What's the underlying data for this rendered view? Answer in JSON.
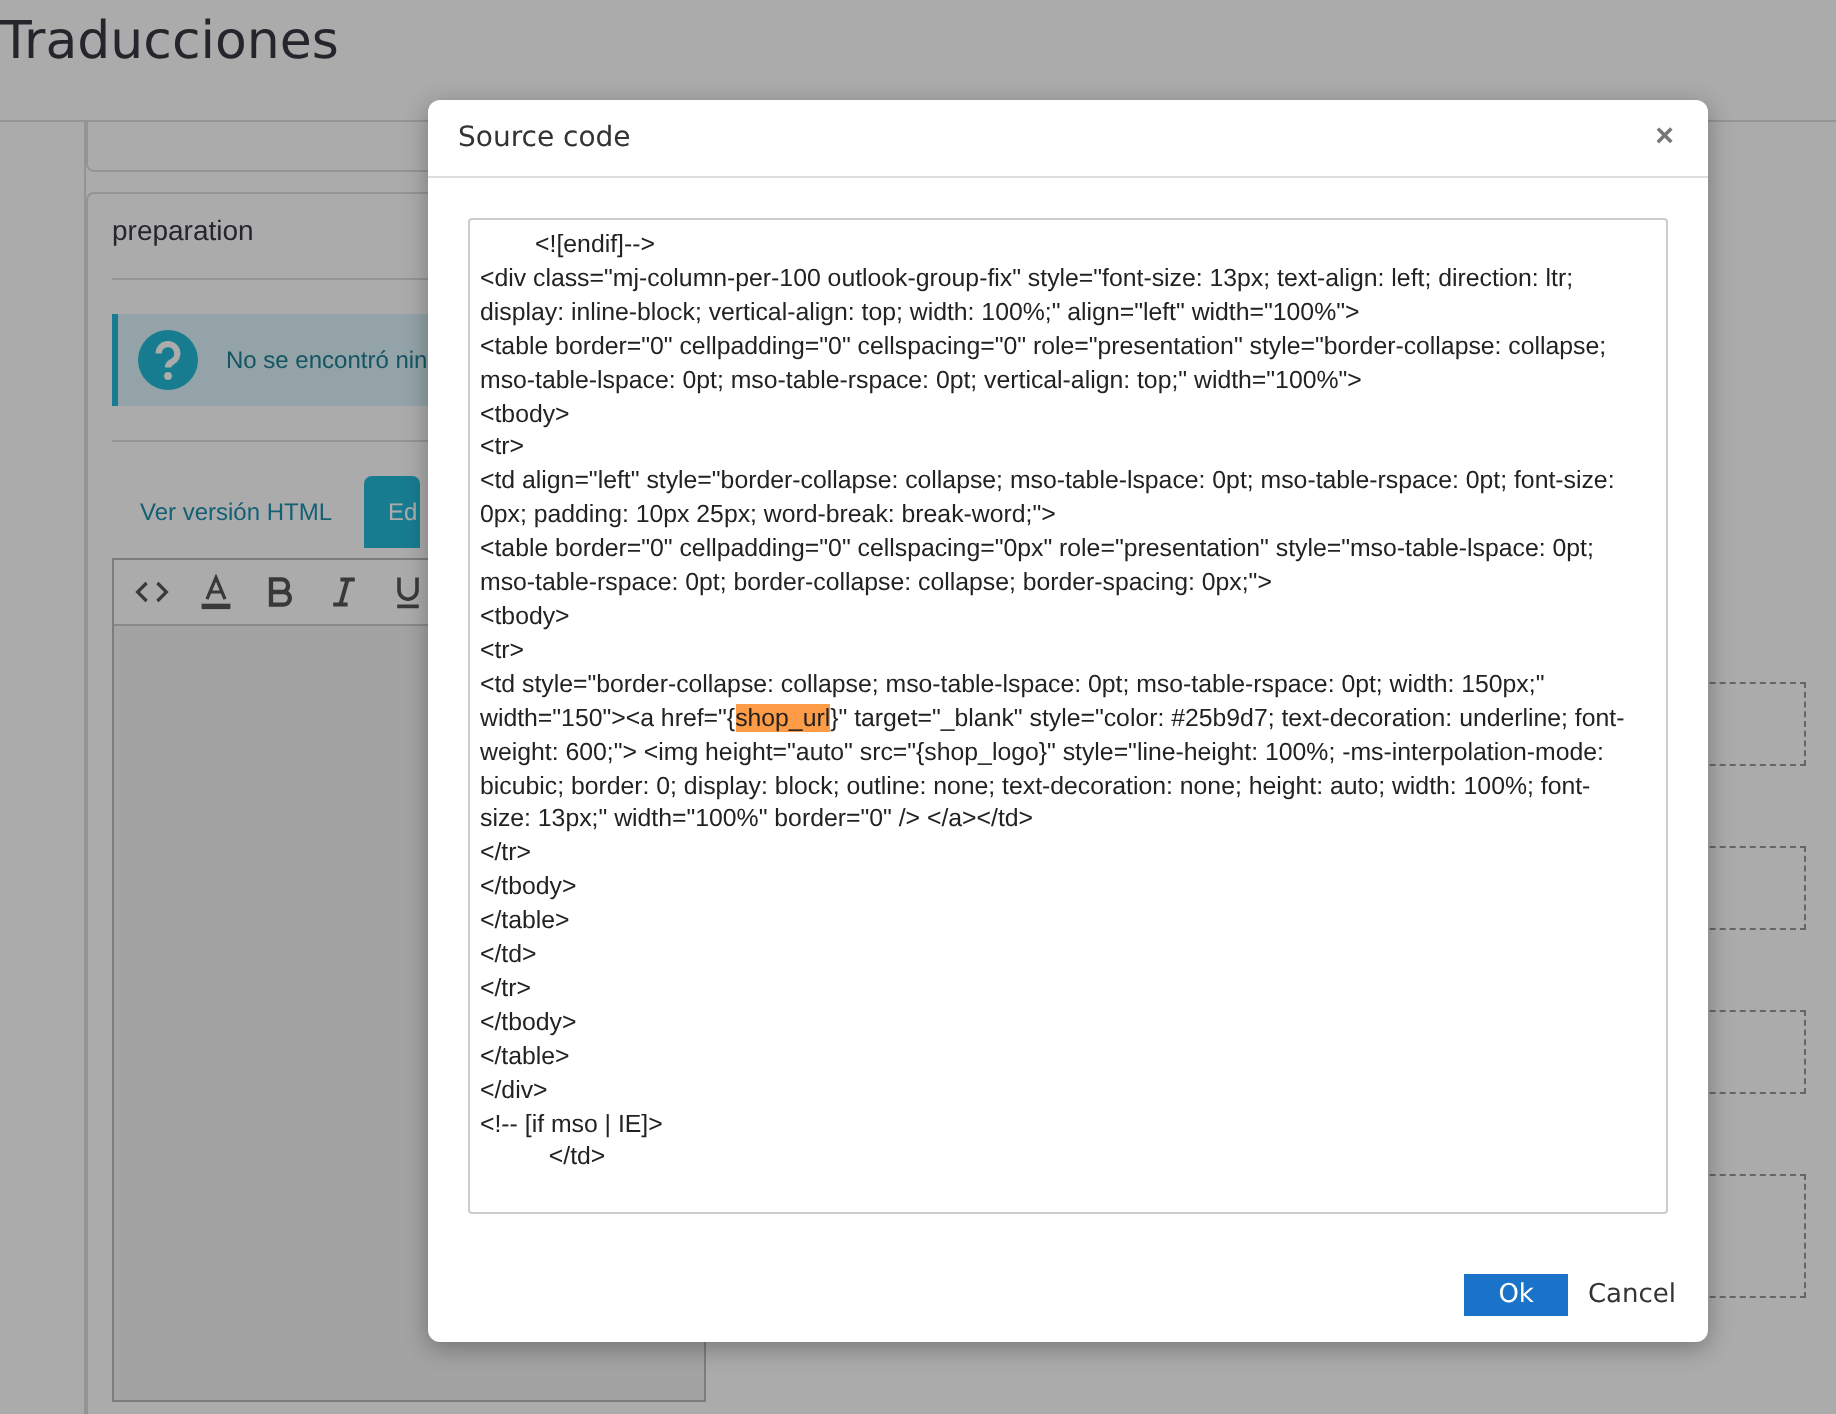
{
  "page": {
    "title": "Traducciones"
  },
  "panel": {
    "title": "preparation",
    "alert": {
      "text": "No se encontró nin"
    },
    "tabs": [
      {
        "label": "Ver versión HTML",
        "selected": false
      },
      {
        "label": "Ed",
        "selected": true
      }
    ],
    "toolbar": [
      {
        "kind": "code"
      },
      {
        "kind": "color"
      },
      {
        "kind": "bold"
      },
      {
        "kind": "italic"
      },
      {
        "kind": "underline"
      }
    ]
  },
  "dialog": {
    "title": "Source code",
    "close": "×",
    "lines": [
      {
        "text": "        <![endif]-->"
      },
      {
        "text": "<div class=\"mj-column-per-100 outlook-group-fix\" style=\"font-size: 13px; text-align: left; direction: ltr;"
      },
      {
        "text": "display: inline-block; vertical-align: top; width: 100%;\" align=\"left\" width=\"100%\">"
      },
      {
        "text": "<table border=\"0\" cellpadding=\"0\" cellspacing=\"0\" role=\"presentation\" style=\"border-collapse: collapse;"
      },
      {
        "text": "mso-table-lspace: 0pt; mso-table-rspace: 0pt; vertical-align: top;\" width=\"100%\">"
      },
      {
        "text": "<tbody>"
      },
      {
        "text": "<tr>"
      },
      {
        "text": "<td align=\"left\" style=\"border-collapse: collapse; mso-table-lspace: 0pt; mso-table-rspace: 0pt; font-size:"
      },
      {
        "text": "0px; padding: 10px 25px; word-break: break-word;\">"
      },
      {
        "text": "<table border=\"0\" cellpadding=\"0\" cellspacing=\"0px\" role=\"presentation\" style=\"mso-table-lspace: 0pt;"
      },
      {
        "text": "mso-table-rspace: 0pt; border-collapse: collapse; border-spacing: 0px;\">"
      },
      {
        "text": "<tbody>"
      },
      {
        "text": "<tr>"
      },
      {
        "text": "<td style=\"border-collapse: collapse; mso-table-lspace: 0pt; mso-table-rspace: 0pt; width: 150px;\""
      },
      {
        "segments": [
          {
            "text": "width=\"150\"><a href=\"{",
            "highlighted": false
          },
          {
            "text": "shop_url",
            "highlighted": true
          },
          {
            "text": "}\" target=\"_blank\" style=\"color: #25b9d7; text-decoration: underline; font-",
            "highlighted": false
          }
        ]
      },
      {
        "text": "weight: 600;\"> <img height=\"auto\" src=\"{shop_logo}\" style=\"line-height: 100%; -ms-interpolation-mode:"
      },
      {
        "text": "bicubic; border: 0; display: block; outline: none; text-decoration: none; height: auto; width: 100%; font-"
      },
      {
        "text": "size: 13px;\" width=\"100%\" border=\"0\" /> </a></td>"
      },
      {
        "text": "</tr>"
      },
      {
        "text": "</tbody>"
      },
      {
        "text": "</table>"
      },
      {
        "text": "</td>"
      },
      {
        "text": "</tr>"
      },
      {
        "text": "</tbody>"
      },
      {
        "text": "</table>"
      },
      {
        "text": "</div>"
      },
      {
        "text": "<!-- [if mso | IE]>"
      },
      {
        "text": "          </td>"
      }
    ],
    "buttons": [
      {
        "label": "Ok",
        "kind": "primary"
      },
      {
        "label": "Cancel",
        "kind": "plain"
      }
    ]
  }
}
